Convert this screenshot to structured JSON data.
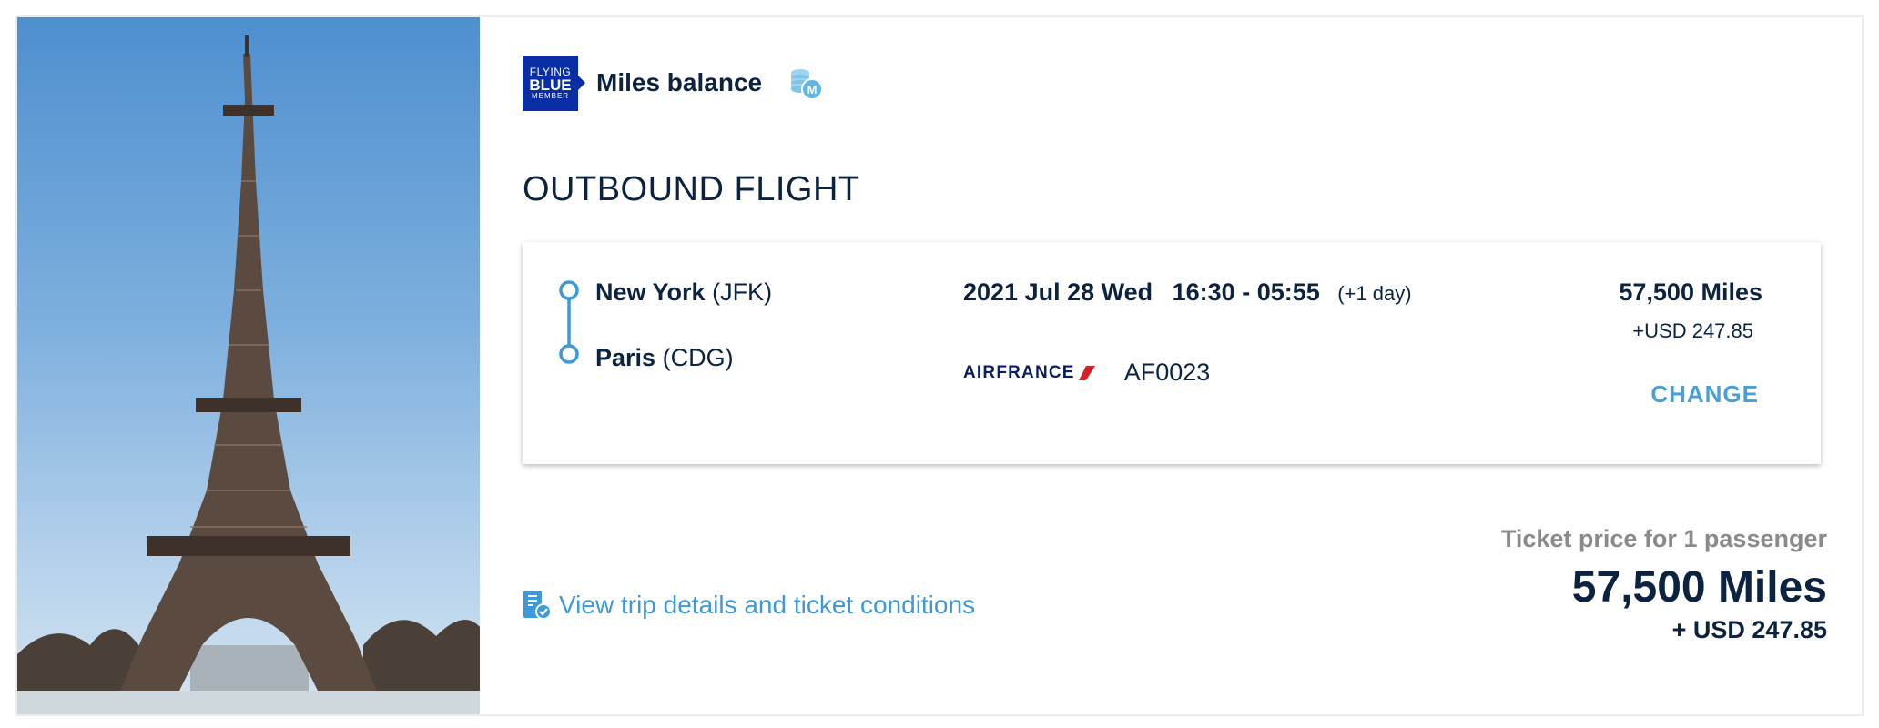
{
  "membership": {
    "logo_line1": "FLYING",
    "logo_line2": "BLUE",
    "logo_line3": "MEMBER",
    "balance_label": "Miles balance",
    "balance_icon": "miles-coins-icon",
    "badge_letter": "M"
  },
  "section_title": "OUTBOUND FLIGHT",
  "flight": {
    "origin_city": "New York",
    "origin_code": "(JFK)",
    "destination_city": "Paris",
    "destination_code": "(CDG)",
    "date": "2021 Jul 28 Wed",
    "time": "16:30 - 05:55",
    "day_offset": "(+1 day)",
    "airline_logo_text": "AIRFRANCE",
    "flight_number": "AF0023",
    "price_miles": "57,500 Miles",
    "price_usd": "+USD 247.85",
    "change_label": "CHANGE"
  },
  "trip_link": {
    "icon": "ticket-check-icon",
    "label": "View trip details and ticket conditions"
  },
  "total": {
    "caption": "Ticket price for 1 passenger",
    "miles": "57,500 Miles",
    "usd": "+ USD 247.85"
  },
  "colors": {
    "navy": "#0c2340",
    "accent_blue": "#4a9fd6",
    "flying_blue": "#0a2fa5",
    "muted_gray": "#8a8a8a",
    "air_france_red": "#d2232a"
  }
}
